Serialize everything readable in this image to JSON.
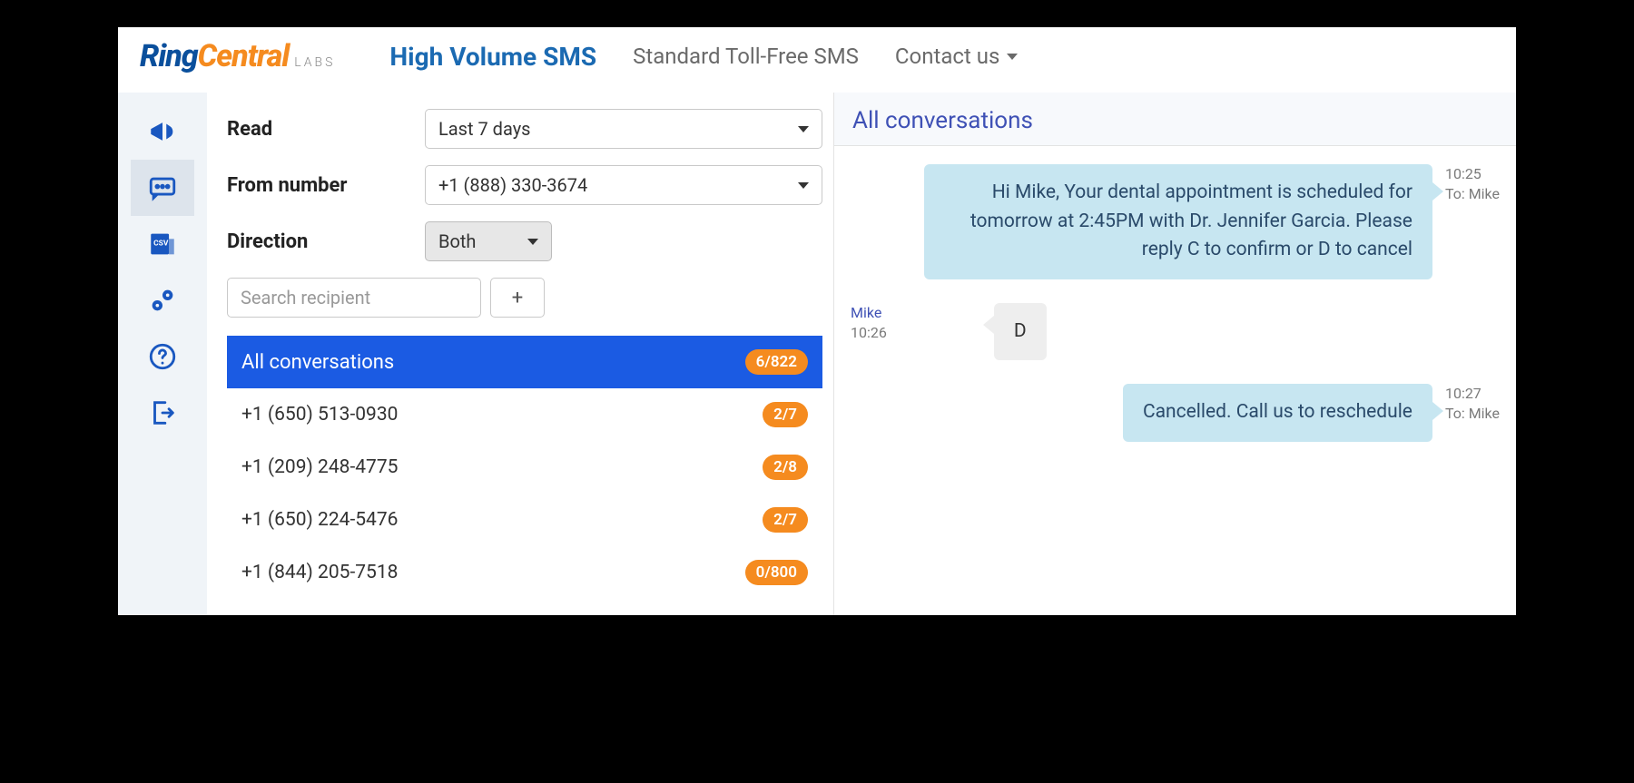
{
  "brand": {
    "ring": "Ring",
    "central": "Central",
    "labs": "LABS"
  },
  "nav": {
    "active": "High Volume SMS",
    "link1": "Standard Toll-Free SMS",
    "link2": "Contact us"
  },
  "filters": {
    "read_label": "Read",
    "read_value": "Last 7 days",
    "from_label": "From number",
    "from_value": "+1 (888) 330-3674",
    "direction_label": "Direction",
    "direction_value": "Both",
    "search_placeholder": "Search recipient",
    "plus": "+"
  },
  "conversations": {
    "header": "All conversations",
    "header_badge": "6/822",
    "items": [
      {
        "label": "+1 (650) 513-0930",
        "badge": "2/7"
      },
      {
        "label": "+1 (209) 248-4775",
        "badge": "2/8"
      },
      {
        "label": "+1 (650) 224-5476",
        "badge": "2/7"
      },
      {
        "label": "+1 (844) 205-7518",
        "badge": "0/800"
      }
    ]
  },
  "chat": {
    "title": "All conversations",
    "messages": [
      {
        "dir": "out",
        "text": "Hi Mike, Your dental appointment is scheduled for tomorrow at 2:45PM with Dr. Jennifer Garcia. Please reply C to confirm or D to cancel",
        "time": "10:25",
        "to": "To: Mike"
      },
      {
        "dir": "in",
        "text": "D",
        "time": "10:26",
        "from": "Mike"
      },
      {
        "dir": "out",
        "text": "Cancelled. Call us to reschedule",
        "time": "10:27",
        "to": "To: Mike"
      }
    ]
  }
}
